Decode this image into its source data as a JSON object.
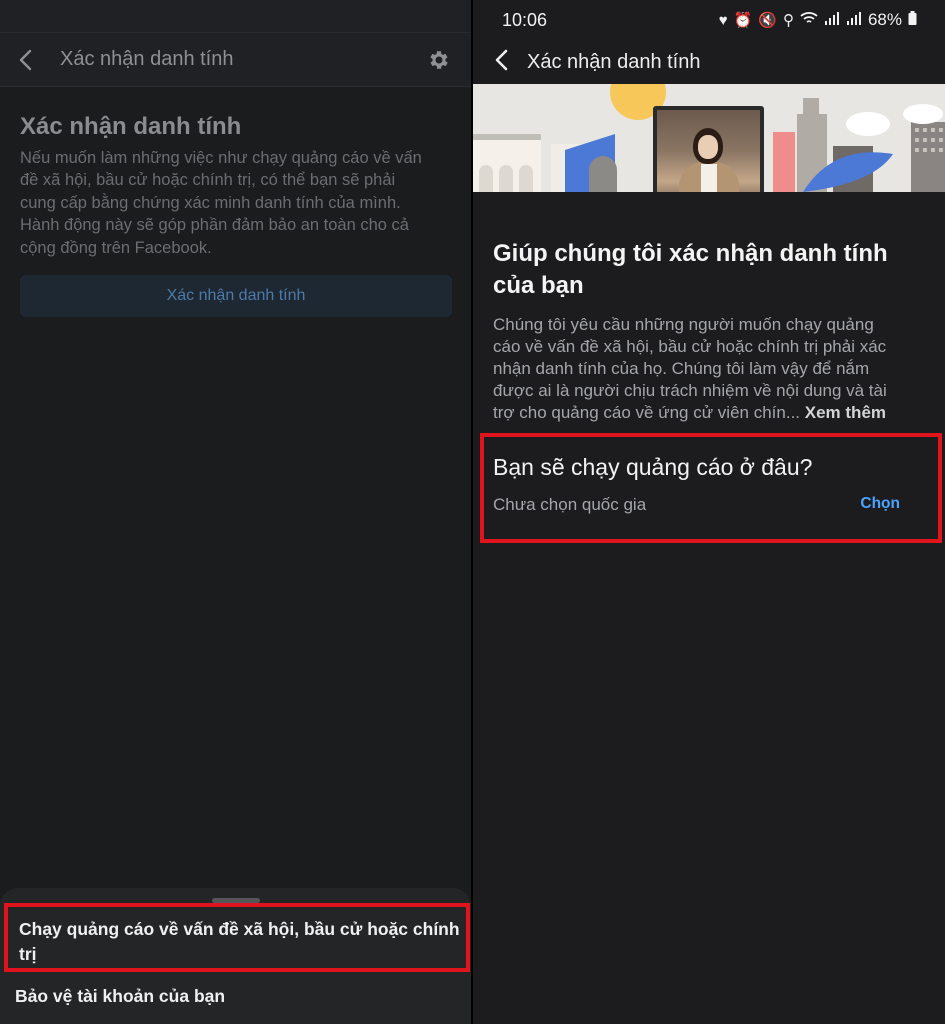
{
  "left": {
    "header": {
      "title": "Xác nhận danh tính",
      "back_icon": "chevron-left-icon",
      "settings_icon": "gear-icon"
    },
    "section_title": "Xác nhận danh tính",
    "description_lines": [
      "Nếu muốn làm những việc như chạy quảng cáo về vấn",
      "đề xã hội, bầu cử hoặc chính trị, có thể bạn sẽ phải",
      "cung cấp bằng chứng xác minh danh tính của mình.",
      "Hành động này sẽ góp phần đảm bảo an toàn cho cả",
      "cộng đồng trên Facebook."
    ],
    "verify_button": "Xác nhận danh tính",
    "sheet": {
      "option1_line1": "Chạy quảng cáo về vấn đề xã hội, bầu cử hoặc chính",
      "option1_line2": "trị",
      "option2": "Bảo vệ tài khoản của bạn"
    }
  },
  "right": {
    "status": {
      "time": "10:06",
      "battery": "68%"
    },
    "header": {
      "title": "Xác nhận danh tính",
      "back_icon": "arrow-left-icon"
    },
    "title_lines": [
      "Giúp chúng tôi xác nhận danh tính",
      "của bạn"
    ],
    "desc_lines": [
      "Chúng tôi yêu cầu những người muốn chạy quảng",
      "cáo về vấn đề xã hội, bầu cử hoặc chính trị phải xác",
      "nhận danh tính của họ. Chúng tôi làm vậy để nắm",
      "được ai là người chịu trách nhiệm về nội dung và tài",
      "trợ cho quảng cáo về ứng cử viên chín..."
    ],
    "see_more": "Xem thêm",
    "country": {
      "question": "Bạn sẽ chạy quảng cáo ở đâu?",
      "status": "Chưa chọn quốc gia",
      "choose": "Chọn"
    }
  },
  "colors": {
    "highlight": "#e0141c",
    "link": "#4aa3ff"
  }
}
